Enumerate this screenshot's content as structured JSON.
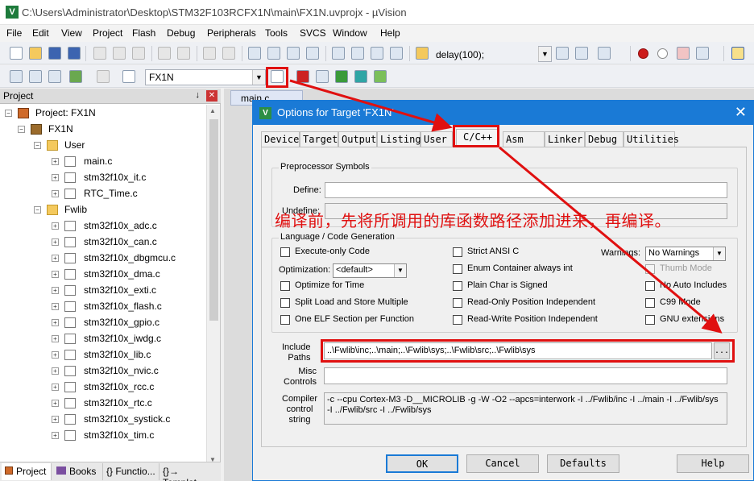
{
  "window": {
    "title": "C:\\Users\\Administrator\\Desktop\\STM32F103RCFX1N\\main\\FX1N.uvprojx - µVision"
  },
  "menu": [
    "File",
    "Edit",
    "View",
    "Project",
    "Flash",
    "Debug",
    "Peripherals",
    "Tools",
    "SVCS",
    "Window",
    "Help"
  ],
  "toolbar": {
    "find_value": "delay(100);",
    "target_value": "FX1N"
  },
  "project_panel": {
    "header": "Project",
    "pin": "↓",
    "root": "Project: FX1N",
    "target": "FX1N",
    "groups": [
      {
        "name": "User",
        "files": [
          "main.c",
          "stm32f10x_it.c",
          "RTC_Time.c"
        ]
      },
      {
        "name": "Fwlib",
        "files": [
          "stm32f10x_adc.c",
          "stm32f10x_can.c",
          "stm32f10x_dbgmcu.c",
          "stm32f10x_dma.c",
          "stm32f10x_exti.c",
          "stm32f10x_flash.c",
          "stm32f10x_gpio.c",
          "stm32f10x_iwdg.c",
          "stm32f10x_lib.c",
          "stm32f10x_nvic.c",
          "stm32f10x_rcc.c",
          "stm32f10x_rtc.c",
          "stm32f10x_systick.c",
          "stm32f10x_tim.c"
        ]
      }
    ],
    "bottom_tabs": [
      "Project",
      "Books",
      "{} Functio...",
      "{}→ Templat..."
    ]
  },
  "editor": {
    "tab": "main.c"
  },
  "dialog": {
    "title": "Options for Target 'FX1N'",
    "close": "✕",
    "tabs": [
      "Device",
      "Target",
      "Output",
      "Listing",
      "User",
      "C/C++",
      "Asm",
      "Linker",
      "Debug",
      "Utilities"
    ],
    "active_tab": "C/C++",
    "preprocessor": {
      "group_label": "Preprocessor Symbols",
      "define_label": "Define:",
      "define_value": "",
      "undefine_label": "Undefine:",
      "undefine_value": ""
    },
    "language": {
      "group_label": "Language / Code Generation",
      "execute_only": "Execute-only Code",
      "optimization_label": "Optimization:",
      "optimization_value": "<default>",
      "optimize_time": "Optimize for Time",
      "split_load": "Split Load and Store Multiple",
      "one_elf": "One ELF Section per Function",
      "strict_ansi": "Strict ANSI C",
      "enum_container": "Enum Container always int",
      "plain_char": "Plain Char is Signed",
      "readonly_pi": "Read-Only Position Independent",
      "readwrite_pi": "Read-Write Position Independent",
      "warnings_label": "Warnings:",
      "warnings_value": "No Warnings",
      "thumb_mode": "Thumb Mode",
      "no_auto_includes": "No Auto Includes",
      "c99_mode": "C99 Mode",
      "gnu_extensions": "GNU extensions"
    },
    "include_paths_label": "Include\nPaths",
    "include_paths_value": "..\\Fwlib\\inc;..\\main;..\\Fwlib\\sys;..\\Fwlib\\src;..\\Fwlib\\sys",
    "browse": "...",
    "misc_label": "Misc\nControls",
    "misc_value": "",
    "compiler_label": "Compiler\ncontrol\nstring",
    "compiler_line1": "-c --cpu Cortex-M3 -D__MICROLIB -g -W -O2 --apcs=interwork -I ../Fwlib/inc -I ../main -I ../Fwlib/sys",
    "compiler_line2": "-I ../Fwlib/src -I ../Fwlib/sys",
    "buttons": {
      "ok": "OK",
      "cancel": "Cancel",
      "defaults": "Defaults",
      "help": "Help"
    }
  },
  "annotation": "编译前，先将所调用的库函数路径添加进来，再编译。",
  "colors": {
    "accent": "#1a7ad6",
    "annotation_red": "#e01010"
  }
}
